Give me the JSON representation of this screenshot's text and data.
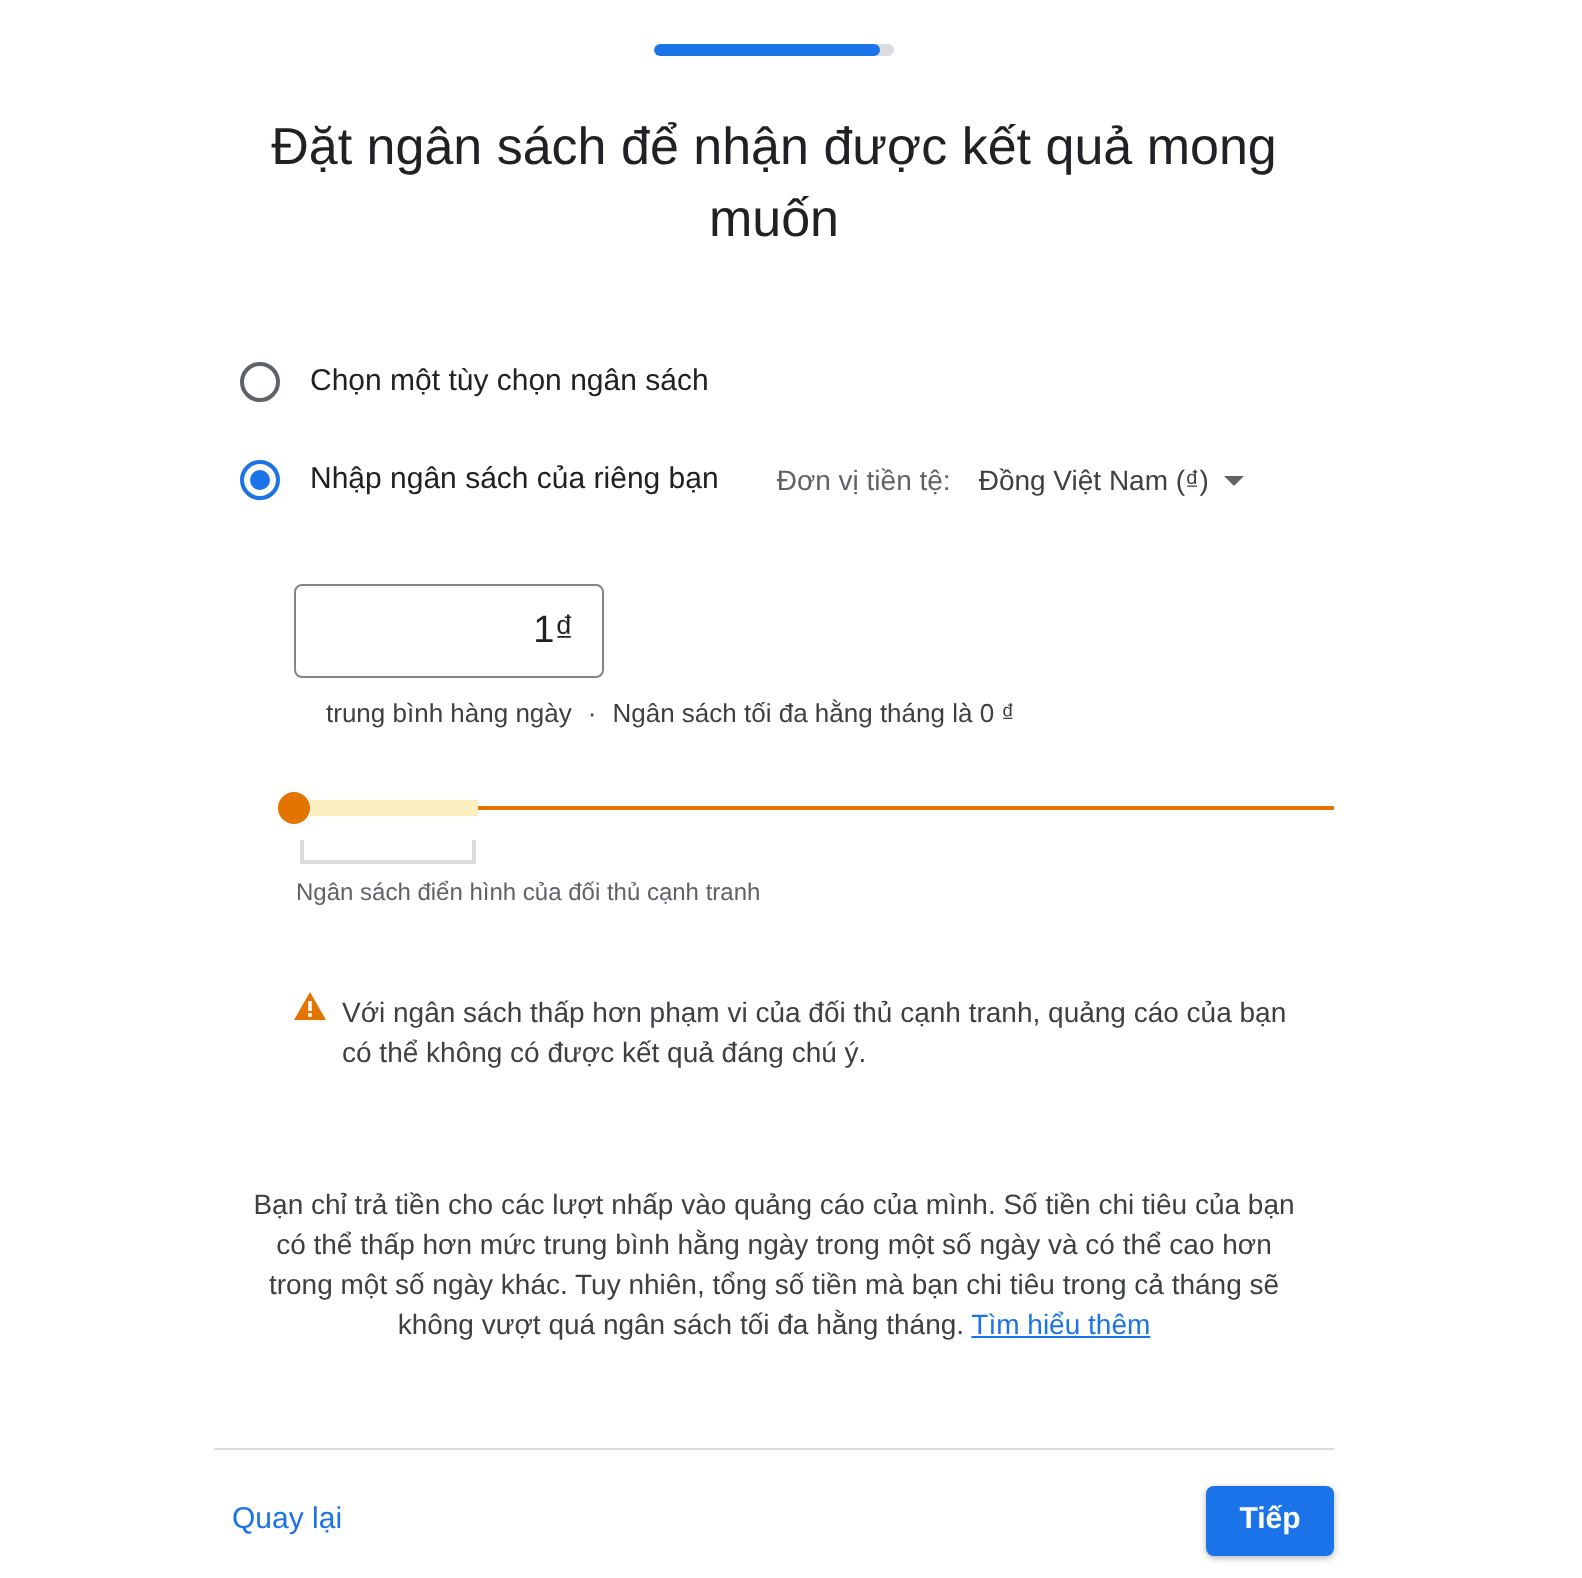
{
  "progress": {
    "level": 0.94
  },
  "title": "Đặt ngân sách để nhận được kết quả mong muốn",
  "budget_options": [
    {
      "label": "Chọn một tùy chọn ngân sách",
      "selected": false
    },
    {
      "label": "Nhập ngân sách của riêng bạn",
      "selected": true
    }
  ],
  "currency": {
    "label": "Đơn vị tiền tệ:",
    "value": "Đồng Việt Nam (₫)"
  },
  "budget_field": {
    "value": "1₫"
  },
  "budget_hint": {
    "period": "trung bình hàng ngày",
    "separator": "·",
    "monthly_max": "Ngân sách tối đa hằng tháng là 0 ₫"
  },
  "budget_slider": {
    "level": 0,
    "range_label": "Ngân sách điển hình của đối thủ cạnh tranh"
  },
  "warning": {
    "text": "Với ngân sách thấp hơn phạm vi của đối thủ cạnh tranh, quảng cáo của bạn có thể không có được kết quả đáng chú ý."
  },
  "info": {
    "text": "Bạn chỉ trả tiền cho các lượt nhấp vào quảng cáo của mình. Số tiền chi tiêu của bạn có thể thấp hơn mức trung bình hằng ngày trong một số ngày và có thể cao hơn trong một số ngày khác. Tuy nhiên, tổng số tiền mà bạn chi tiêu trong cả tháng sẽ không vượt quá ngân sách tối đa hằng tháng.",
    "link": "Tìm hiểu thêm"
  },
  "footer": {
    "back": "Quay lại",
    "next": "Tiếp"
  }
}
